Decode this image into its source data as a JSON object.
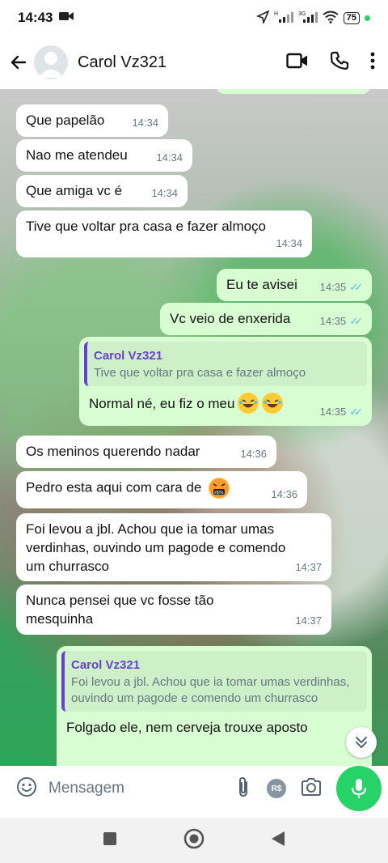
{
  "status_bar": {
    "time": "14:43",
    "battery": "75"
  },
  "header": {
    "contact_name": "Carol Vz321"
  },
  "messages": [
    {
      "dir": "in",
      "text": "Que papelão",
      "time": "14:34"
    },
    {
      "dir": "in",
      "text": "Nao me atendeu",
      "time": "14:34"
    },
    {
      "dir": "in",
      "text": "Que amiga vc é",
      "time": "14:34"
    },
    {
      "dir": "in",
      "text": "Tive que voltar pra casa e fazer almoço",
      "time": "14:34"
    },
    {
      "dir": "out",
      "text": "Eu te avisei",
      "time": "14:35"
    },
    {
      "dir": "out",
      "text": "Vc veio de enxerida",
      "time": "14:35"
    },
    {
      "dir": "out",
      "quote_author": "Carol Vz321",
      "quote_text": "Tive que voltar pra casa e fazer almoço",
      "text": "Normal né, eu fiz o meu",
      "time": "14:35"
    },
    {
      "dir": "in",
      "text": "Os meninos querendo nadar",
      "time": "14:36"
    },
    {
      "dir": "in",
      "text": "Pedro esta aqui com cara de",
      "time": "14:36"
    },
    {
      "dir": "in",
      "text": "Foi levou a jbl. Achou que ia tomar umas verdinhas, ouvindo um pagode e comendo um churrasco",
      "time": "14:37"
    },
    {
      "dir": "in",
      "text": "Nunca pensei que vc fosse tão mesquinha",
      "time": "14:37"
    },
    {
      "dir": "out",
      "quote_author": "Carol Vz321",
      "quote_text": "Foi levou a jbl. Achou que ia tomar umas verdinhas, ouvindo um pagode e comendo um churrasco",
      "text": "Folgado ele, nem cerveja trouxe aposto"
    }
  ],
  "composer": {
    "placeholder": "Mensagem",
    "rs_label": "R$"
  },
  "colors": {
    "accent": "#25d366",
    "outgoing_bubble": "#d9fdd3",
    "quote_author": "#6a3fd6",
    "read_ticks": "#53bdeb"
  }
}
